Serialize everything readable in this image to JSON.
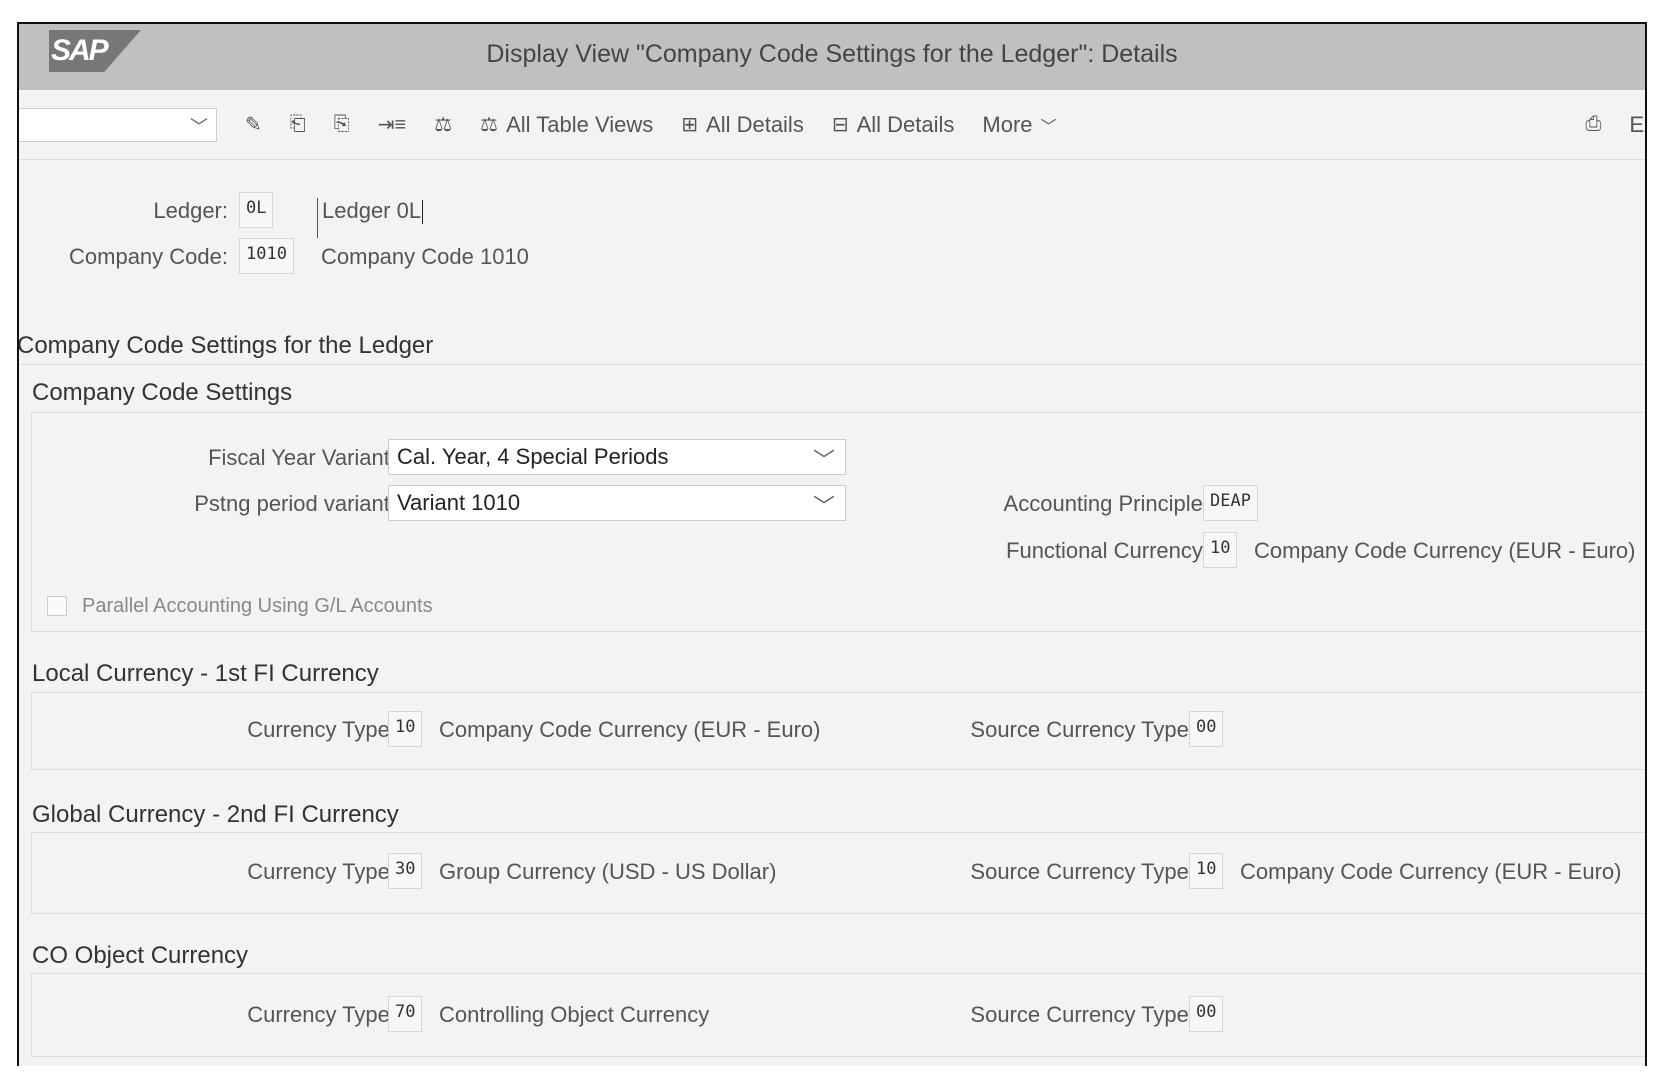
{
  "window": {
    "title": "Display View \"Company Code Settings for the Ledger\": Details",
    "logo": "SAP"
  },
  "toolbar": {
    "items": [
      {
        "icon": "glasses-pencil-icon",
        "label": ""
      },
      {
        "icon": "previous-entry-icon",
        "label": ""
      },
      {
        "icon": "next-entry-icon",
        "label": ""
      },
      {
        "icon": "expand-list-icon",
        "label": ""
      },
      {
        "icon": "balance-icon",
        "label": ""
      },
      {
        "icon": "balance-icon",
        "label": "All Table Views"
      },
      {
        "icon": "expand-details-icon",
        "label": "All Details"
      },
      {
        "icon": "collapse-details-icon",
        "label": "All Details"
      }
    ],
    "more": "More",
    "print_icon": "print-icon",
    "exit": "Ex"
  },
  "header": {
    "ledger_label": "Ledger:",
    "ledger_value": "0L",
    "ledger_desc": "Ledger 0L",
    "company_code_label": "Company Code:",
    "company_code_value": "1010",
    "company_code_desc": "Company Code 1010"
  },
  "section_title": "Company Code Settings for the Ledger",
  "settings": {
    "title": "Company Code Settings",
    "fiscal_year_label": "Fiscal Year Variant:",
    "fiscal_year_value": "Cal. Year, 4 Special Periods",
    "posting_period_label": "Pstng period variant:",
    "posting_period_value": "Variant 1010",
    "accounting_principle_label": "Accounting Principle:",
    "accounting_principle_value": "DEAP",
    "functional_currency_label": "Functional Currency:",
    "functional_currency_value": "10",
    "functional_currency_desc": "Company Code Currency (EUR - Euro)",
    "parallel_label": "Parallel Accounting Using G/L Accounts",
    "parallel_checked": false
  },
  "currencies": [
    {
      "title": "Local Currency - 1st FI Currency",
      "type_label": "Currency Type:",
      "type_value": "10",
      "type_desc": "Company Code Currency (EUR - Euro)",
      "source_label": "Source Currency Type:",
      "source_value": "00",
      "source_desc": ""
    },
    {
      "title": "Global Currency - 2nd FI Currency",
      "type_label": "Currency Type:",
      "type_value": "30",
      "type_desc": "Group Currency (USD - US Dollar)",
      "source_label": "Source Currency Type:",
      "source_value": "10",
      "source_desc": "Company Code Currency (EUR - Euro)"
    },
    {
      "title": "CO Object Currency",
      "type_label": "Currency Type:",
      "type_value": "70",
      "type_desc": "Controlling Object Currency",
      "source_label": "Source Currency Type:",
      "source_value": "00",
      "source_desc": ""
    }
  ]
}
